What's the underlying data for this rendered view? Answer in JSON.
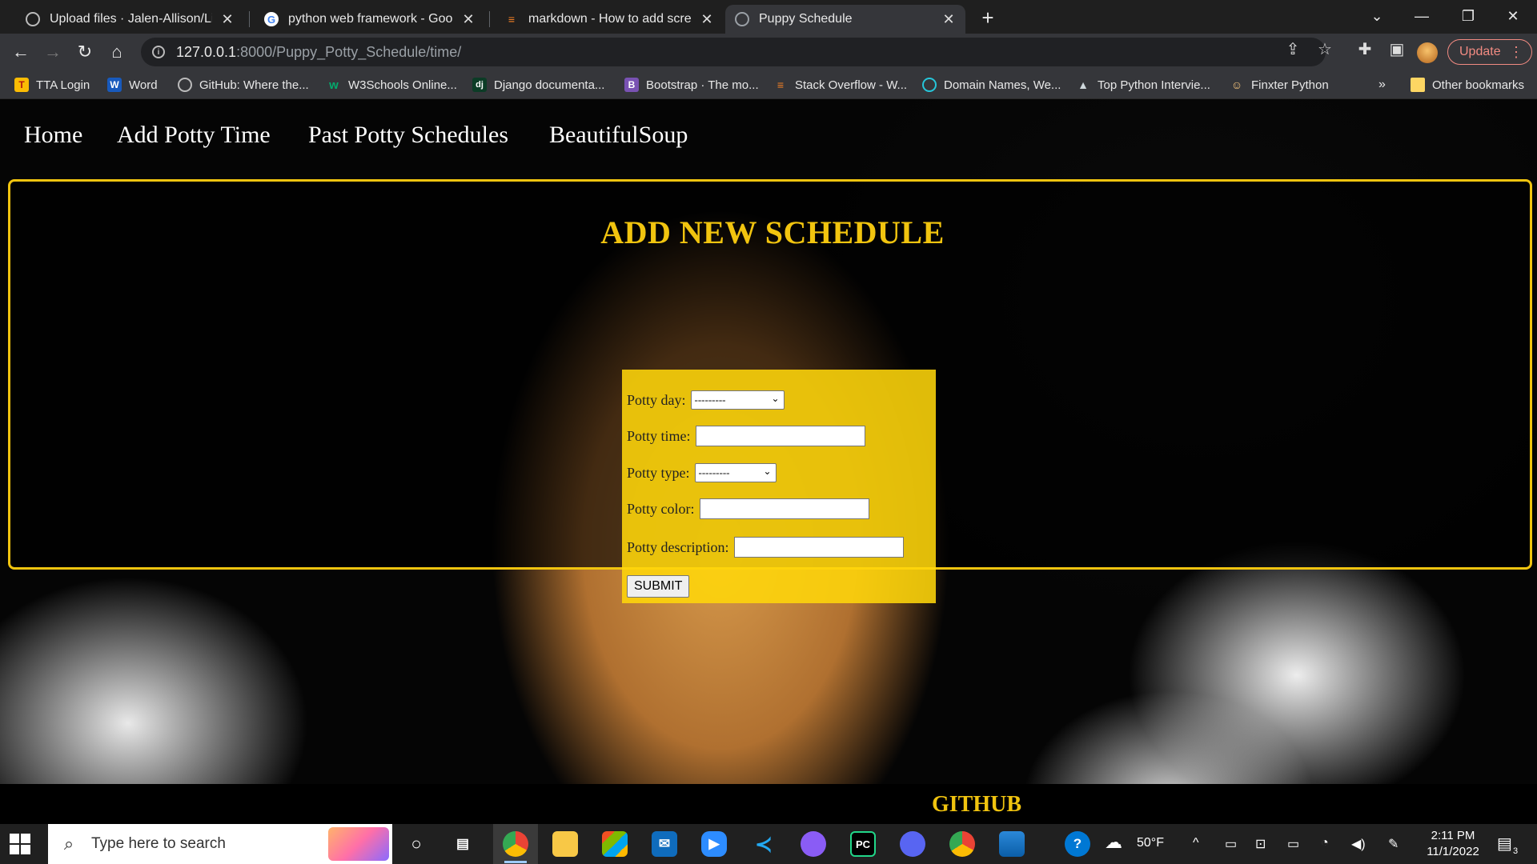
{
  "browser": {
    "tabs": [
      {
        "title": "Upload files · Jalen-Allison/Live-P",
        "icon": "github-icon"
      },
      {
        "title": "python web framework - Google",
        "icon": "google-icon"
      },
      {
        "title": "markdown - How to add screens",
        "icon": "stackoverflow-icon"
      },
      {
        "title": "Puppy Schedule",
        "icon": "globe-icon",
        "active": true
      }
    ],
    "url_host": "127.0.0.1",
    "url_rest": ":8000/Puppy_Potty_Schedule/time/",
    "update_label": "Update",
    "bookmarks": [
      {
        "label": "TTA Login",
        "icon": "tta-icon"
      },
      {
        "label": "Word",
        "icon": "word-icon"
      },
      {
        "label": "GitHub: Where the...",
        "icon": "github-icon"
      },
      {
        "label": "W3Schools Online...",
        "icon": "w3schools-icon"
      },
      {
        "label": "Django documenta...",
        "icon": "django-icon"
      },
      {
        "label": "Bootstrap · The mo...",
        "icon": "bootstrap-icon"
      },
      {
        "label": "Stack Overflow - W...",
        "icon": "stackoverflow-icon"
      },
      {
        "label": "Domain Names, We...",
        "icon": "domain-icon"
      },
      {
        "label": "Top Python Intervie...",
        "icon": "mountain-icon"
      },
      {
        "label": "Finxter Python",
        "icon": "finxter-icon"
      }
    ],
    "more_bookmarks": "»",
    "other_bookmarks": "Other bookmarks"
  },
  "page": {
    "nav": [
      "Home",
      "Add Potty Time",
      "Past Potty Schedules",
      "BeautifulSoup"
    ],
    "heading": "ADD NEW SCHEDULE",
    "form": {
      "day_label": "Potty day:",
      "day_value": "---------",
      "time_label": "Potty time:",
      "type_label": "Potty type:",
      "type_value": "---------",
      "color_label": "Potty color:",
      "description_label": "Potty description:",
      "submit_label": "SUBMIT"
    },
    "footer_link": "GITHUB",
    "accent_color": "#f1c40f"
  },
  "taskbar": {
    "search_placeholder": "Type here to search",
    "weather": "50°F",
    "time": "2:11 PM",
    "date": "11/1/2022",
    "notification_count": "3"
  }
}
